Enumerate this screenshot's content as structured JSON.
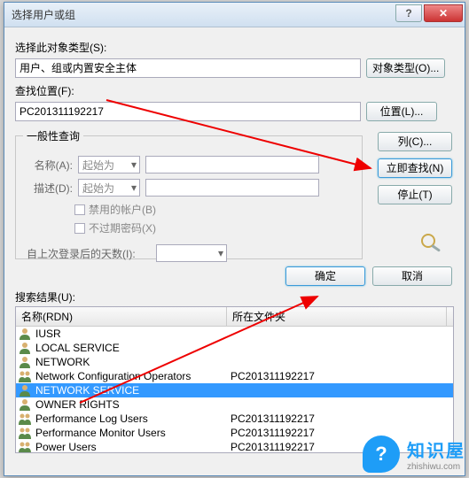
{
  "title": "选择用户或组",
  "labels": {
    "object_type": "选择此对象类型(S):",
    "object_value": "用户、组或内置安全主体",
    "btn_object": "对象类型(O)...",
    "location": "查找位置(F):",
    "location_value": "PC201311192217",
    "btn_location": "位置(L)...",
    "group": "一般性查询",
    "name": "名称(A):",
    "desc": "描述(D):",
    "combo": "起始为",
    "chk_disabled": "禁用的帐户(B)",
    "chk_noexpire": "不过期密码(X)",
    "days": "自上次登录后的天数(I):",
    "btn_columns": "列(C)...",
    "btn_findnow": "立即查找(N)",
    "btn_stop": "停止(T)",
    "btn_ok": "确定",
    "btn_cancel": "取消",
    "results": "搜索结果(U):",
    "col_name": "名称(RDN)",
    "col_folder": "所在文件夹"
  },
  "results": [
    {
      "name": "IUSR",
      "folder": "",
      "type": "user"
    },
    {
      "name": "LOCAL SERVICE",
      "folder": "",
      "type": "user"
    },
    {
      "name": "NETWORK",
      "folder": "",
      "type": "user"
    },
    {
      "name": "Network Configuration Operators",
      "folder": "PC201311192217",
      "type": "group"
    },
    {
      "name": "NETWORK SERVICE",
      "folder": "",
      "type": "user",
      "selected": true
    },
    {
      "name": "OWNER RIGHTS",
      "folder": "",
      "type": "user"
    },
    {
      "name": "Performance Log Users",
      "folder": "PC201311192217",
      "type": "group"
    },
    {
      "name": "Performance Monitor Users",
      "folder": "PC201311192217",
      "type": "group"
    },
    {
      "name": "Power Users",
      "folder": "PC201311192217",
      "type": "group"
    }
  ],
  "brand": {
    "name": "知识屋",
    "url": "zhishiwu.com",
    "badge": "?"
  }
}
